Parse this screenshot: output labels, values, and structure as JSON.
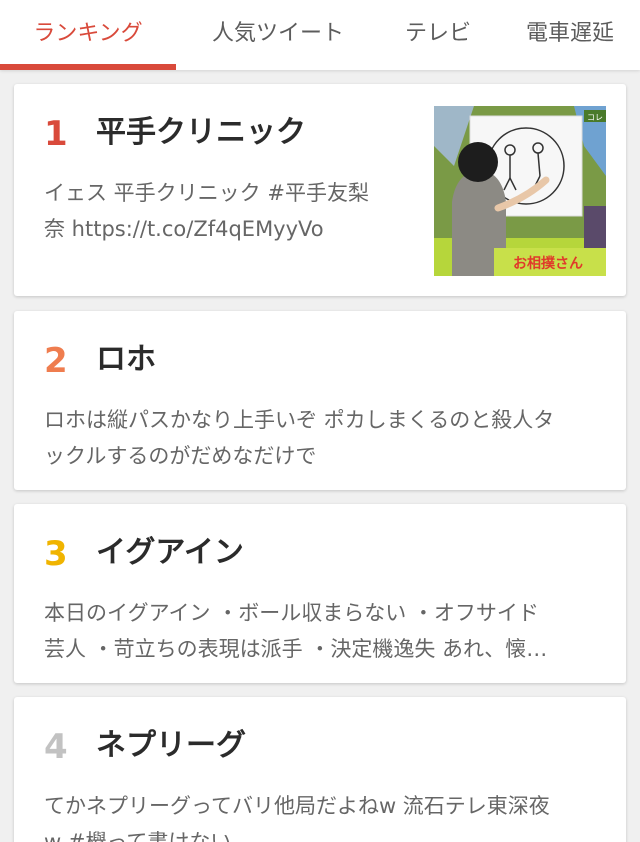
{
  "tabs": [
    {
      "label": "ランキング",
      "active": true
    },
    {
      "label": "人気ツイート",
      "active": false
    },
    {
      "label": "テレビ",
      "active": false
    },
    {
      "label": "電車遅延",
      "active": false
    }
  ],
  "colors": {
    "accent": "#d94a3b",
    "rank_1": "#d94a3b",
    "rank_2": "#ef7d4f",
    "rank_3": "#f0b400",
    "rank_4": "#c2c2c2"
  },
  "rankings": [
    {
      "rank": "1",
      "title": "平手クリニック",
      "snippet_line1": "イェス 平手クリニック #平手友梨",
      "snippet_line2": "奈 https://t.co/Zf4qEMyyVo",
      "thumbnail": {
        "caption": "お相撲さん",
        "corner_text": "コレ"
      }
    },
    {
      "rank": "2",
      "title": "ロホ",
      "snippet_line1": "ロホは縦パスかなり上手いぞ ポカしまくるのと殺人タ",
      "snippet_line2": "ックルするのがだめなだけで"
    },
    {
      "rank": "3",
      "title": "イグアイン",
      "snippet_line1": "本日のイグアイン ・ボール収まらない ・オフサイド",
      "snippet_line2": "芸人 ・苛立ちの表現は派手 ・決定機逸失 あれ、懐…"
    },
    {
      "rank": "4",
      "title": "ネプリーグ",
      "snippet_line1": "てかネプリーグってバリ他局だよねw 流石テレ東深夜",
      "snippet_line2": "w #欅って書けない"
    }
  ]
}
